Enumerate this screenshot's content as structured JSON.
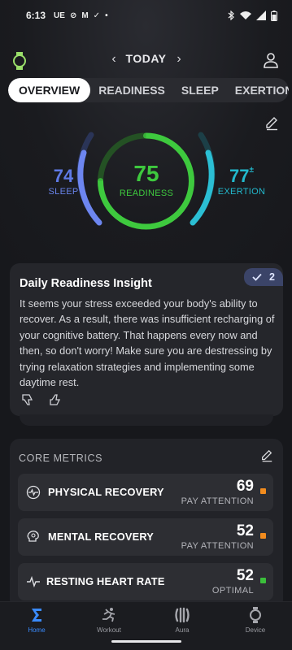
{
  "status_bar": {
    "time": "6:13",
    "notifications": [
      "UE",
      "⊘",
      "M",
      "✓",
      "•"
    ]
  },
  "header": {
    "date_label": "TODAY",
    "prev": "‹",
    "next": "›"
  },
  "tabs": [
    {
      "label": "OVERVIEW",
      "active": true
    },
    {
      "label": "READINESS",
      "active": false
    },
    {
      "label": "SLEEP",
      "active": false
    },
    {
      "label": "EXERTION",
      "active": false
    }
  ],
  "scores": {
    "sleep": {
      "value": "74",
      "label": "SLEEP",
      "color": "#5b78e6"
    },
    "readiness": {
      "value": "75",
      "label": "READINESS",
      "color": "#3bbf3b"
    },
    "exertion": {
      "value": "77",
      "sup": "±",
      "label": "EXERTION",
      "color": "#23b3c8"
    }
  },
  "insight": {
    "title": "Daily Readiness Insight",
    "badge_count": "2",
    "text": "It seems your stress exceeded your body's ability to recover. As a result, there was insufficient recharging of your cognitive battery. That happens every now and then, so don't worry! Make sure you are destressing by trying relaxation strategies and implementing some daytime rest."
  },
  "core_metrics": {
    "title": "CORE METRICS",
    "items": [
      {
        "name": "PHYSICAL RECOVERY",
        "value": "69",
        "status": "PAY ATTENTION",
        "dot": "#f28c1e",
        "icon": "pulse-icon"
      },
      {
        "name": "MENTAL RECOVERY",
        "value": "52",
        "status": "PAY ATTENTION",
        "dot": "#f28c1e",
        "icon": "brain-icon"
      },
      {
        "name": "RESTING HEART RATE",
        "value": "52",
        "status": "OPTIMAL",
        "dot": "#3bbf3b",
        "icon": "heartbeat-icon"
      }
    ]
  },
  "bottom_nav": [
    {
      "label": "Home",
      "active": true,
      "icon": "home-sigma-icon"
    },
    {
      "label": "Workout",
      "active": false,
      "icon": "workout-icon"
    },
    {
      "label": "Aura",
      "active": false,
      "icon": "aura-icon"
    },
    {
      "label": "Device",
      "active": false,
      "icon": "device-icon"
    }
  ]
}
